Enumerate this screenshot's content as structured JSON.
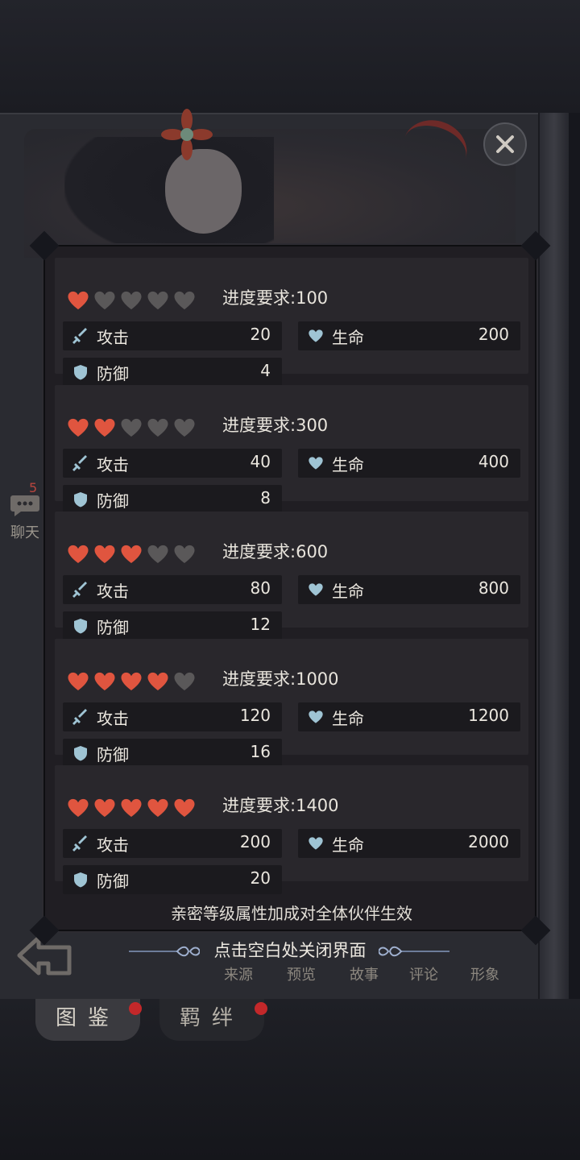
{
  "background": {
    "chat_badge": "5",
    "chat_label": "聊天",
    "bottom_nav": [
      "来源",
      "预览",
      "故事",
      "评论",
      "形象"
    ],
    "tabs": [
      "图鉴",
      "羁绊"
    ]
  },
  "panel": {
    "requirement_label": "进度要求:",
    "attack_label": "攻击",
    "life_label": "生命",
    "defense_label": "防御",
    "tiers": [
      {
        "hearts_filled": 1,
        "hearts_total": 5,
        "requirement": "100",
        "attack": "20",
        "life": "200",
        "defense": "4"
      },
      {
        "hearts_filled": 2,
        "hearts_total": 5,
        "requirement": "300",
        "attack": "40",
        "life": "400",
        "defense": "8"
      },
      {
        "hearts_filled": 3,
        "hearts_total": 5,
        "requirement": "600",
        "attack": "80",
        "life": "800",
        "defense": "12"
      },
      {
        "hearts_filled": 4,
        "hearts_total": 5,
        "requirement": "1000",
        "attack": "120",
        "life": "1200",
        "defense": "16"
      },
      {
        "hearts_filled": 5,
        "hearts_total": 5,
        "requirement": "1400",
        "attack": "200",
        "life": "2000",
        "defense": "20"
      }
    ],
    "footer_note": "亲密等级属性加成对全体伙伴生效"
  },
  "close_hint": "点击空白处关闭界面",
  "colors": {
    "heart_filled": "#e0553f",
    "heart_empty": "#5a5859",
    "stat_icon": "#9fc4d4",
    "panel_bg": "#201e23",
    "tier_bg": "#29272c",
    "row_bg": "#1b1a1e"
  },
  "icons": {
    "attack": "sword-icon",
    "life": "heart-icon",
    "defense": "shield-icon",
    "close": "close-icon"
  }
}
